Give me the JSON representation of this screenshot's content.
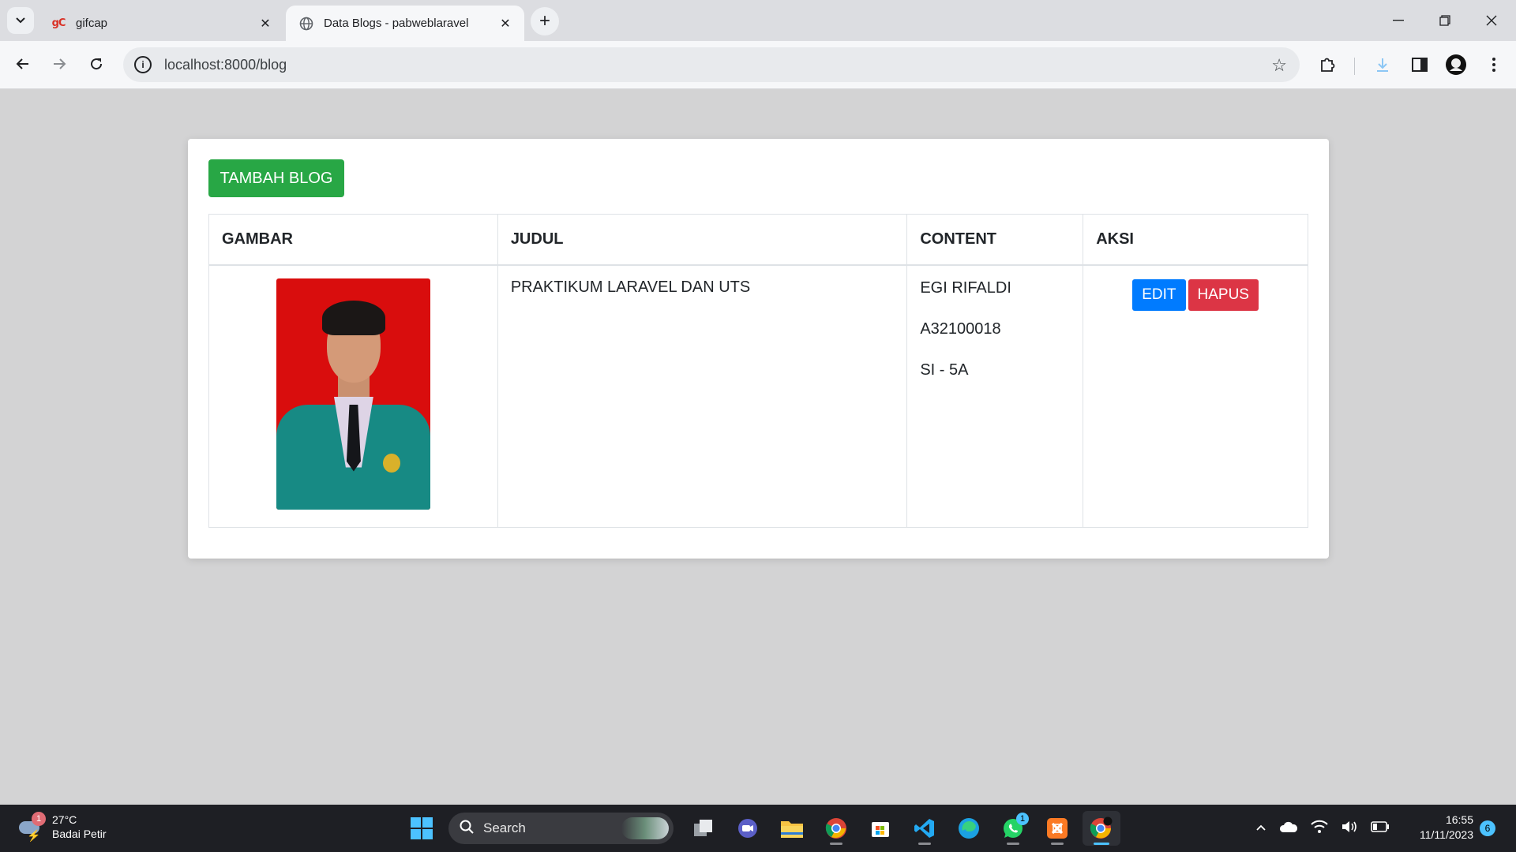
{
  "browser": {
    "tabs": [
      {
        "title": "gifcap",
        "favicon": "gC"
      },
      {
        "title": "Data Blogs - pabweblaravel",
        "favicon": "globe-icon"
      }
    ],
    "url": "localhost:8000/blog"
  },
  "page": {
    "add_button": "TAMBAH BLOG",
    "columns": [
      "GAMBAR",
      "JUDUL",
      "CONTENT",
      "AKSI"
    ],
    "rows": [
      {
        "gambar": "student-photo",
        "judul": "PRAKTIKUM LARAVEL DAN UTS",
        "content": [
          "EGI RIFALDI",
          "A32100018",
          "SI - 5A"
        ],
        "edit_label": "EDIT",
        "delete_label": "HAPUS"
      }
    ]
  },
  "taskbar": {
    "weather": {
      "temp": "27°C",
      "condition": "Badai Petir",
      "alerts": "1"
    },
    "search_label": "Search",
    "whatsapp_badge": "1",
    "time": "16:55",
    "date": "11/11/2023",
    "notifications": "6"
  },
  "colors": {
    "add_button": "#28a745",
    "edit_button": "#007bff",
    "delete_button": "#dc3545"
  }
}
